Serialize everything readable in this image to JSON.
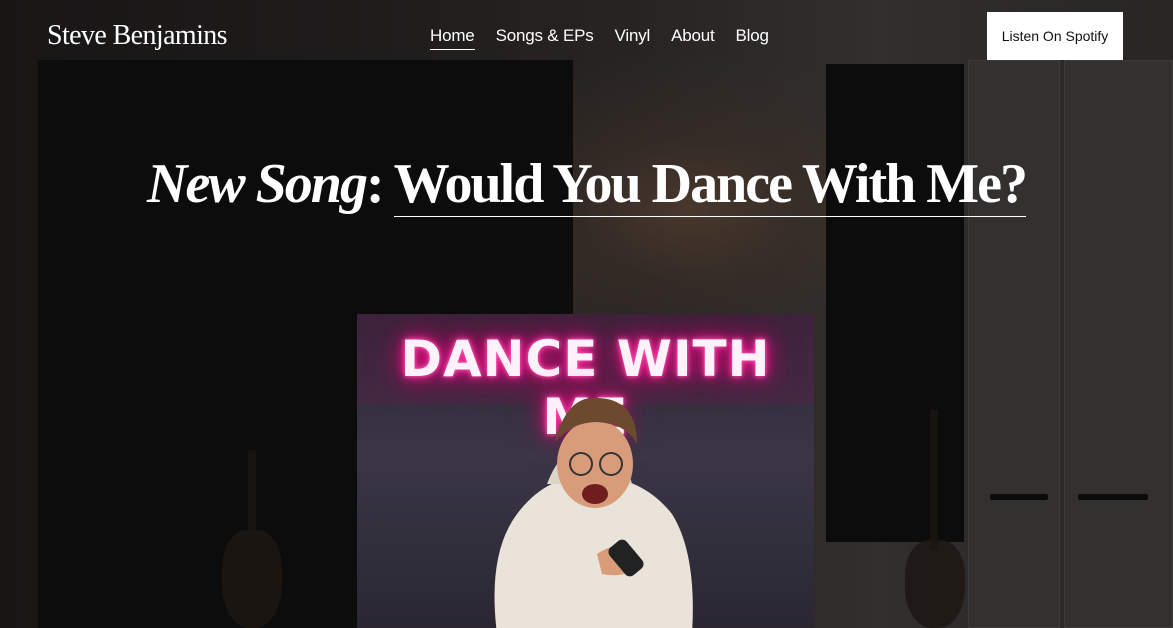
{
  "site": {
    "title": "Steve Benjamins"
  },
  "nav": {
    "items": [
      {
        "label": "Home",
        "active": true
      },
      {
        "label": "Songs & EPs",
        "active": false
      },
      {
        "label": "Vinyl",
        "active": false
      },
      {
        "label": "About",
        "active": false
      },
      {
        "label": "Blog",
        "active": false
      }
    ],
    "cta_label": "Listen On Spotify"
  },
  "hero": {
    "headline_prefix": "New Song",
    "headline_separator": ": ",
    "headline_link": "Would You Dance With Me?",
    "cover_title": "DANCE WITH ME"
  },
  "colors": {
    "neon_pink": "#ff2f9e",
    "cta_background": "#ffffff",
    "text": "#ffffff"
  }
}
